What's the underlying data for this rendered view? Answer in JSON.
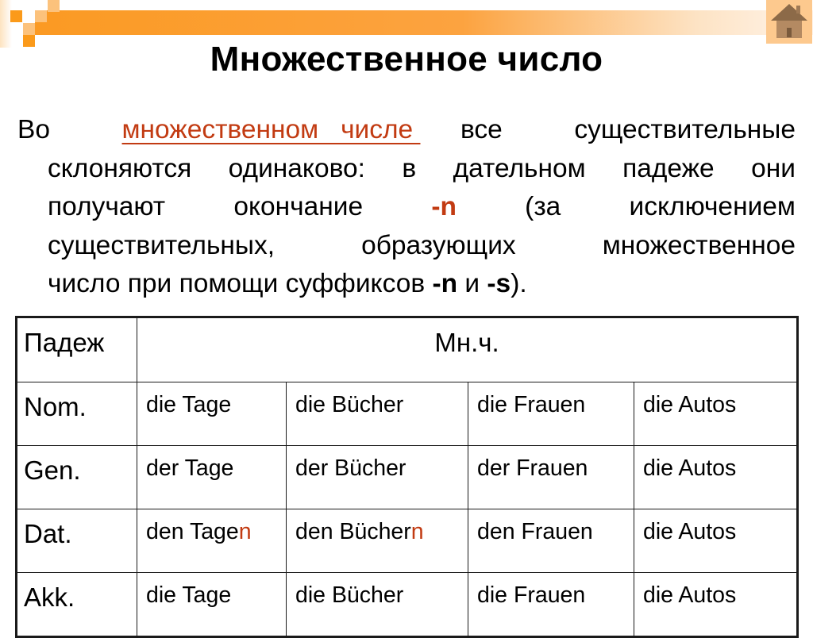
{
  "slide": {
    "title": "Множественное число",
    "home_button_icon": "home-icon",
    "accent_color": "#c23b12",
    "header_bar_color": "#fb9a23",
    "paragraph": {
      "line1": {
        "w1": "Во",
        "link_text": "множественном   числе ",
        "w3": "все",
        "w4": "существительные"
      },
      "line2": [
        "склоняются",
        "одинаково:",
        "в",
        "дательном",
        "падеже",
        "они"
      ],
      "line3": {
        "w1": "получают",
        "w2": "окончание",
        "ending": "-n",
        "w4": "(за",
        "w5": "исключением"
      },
      "line4": [
        "существительных,",
        "образующих",
        "множественное"
      ],
      "line5": {
        "text": "число при помощи суффиксов ",
        "suffix1": "-n",
        "mid": " и ",
        "suffix2": "-s",
        "end": ")."
      }
    }
  },
  "table": {
    "header": {
      "case_label": "Падеж",
      "plural_label": "Мн.ч."
    },
    "rows": [
      {
        "case": "Nom.",
        "cells": [
          {
            "base": "die Tage",
            "ending": ""
          },
          {
            "base": "die Bücher",
            "ending": ""
          },
          {
            "base": "die Frauen",
            "ending": ""
          },
          {
            "base": "die Autos",
            "ending": ""
          }
        ]
      },
      {
        "case": "Gen.",
        "cells": [
          {
            "base": "der Tage",
            "ending": ""
          },
          {
            "base": "der Bücher",
            "ending": ""
          },
          {
            "base": "der Frauen",
            "ending": ""
          },
          {
            "base": "die Autos",
            "ending": ""
          }
        ]
      },
      {
        "case": "Dat.",
        "cells": [
          {
            "base": "den Tage",
            "ending": "n"
          },
          {
            "base": "den Bücher",
            "ending": "n"
          },
          {
            "base": "den Frauen",
            "ending": ""
          },
          {
            "base": "die Autos",
            "ending": ""
          }
        ]
      },
      {
        "case": "Akk.",
        "cells": [
          {
            "base": "die Tage",
            "ending": ""
          },
          {
            "base": "die Bücher",
            "ending": ""
          },
          {
            "base": "die Frauen",
            "ending": ""
          },
          {
            "base": "die Autos",
            "ending": ""
          }
        ]
      }
    ]
  }
}
